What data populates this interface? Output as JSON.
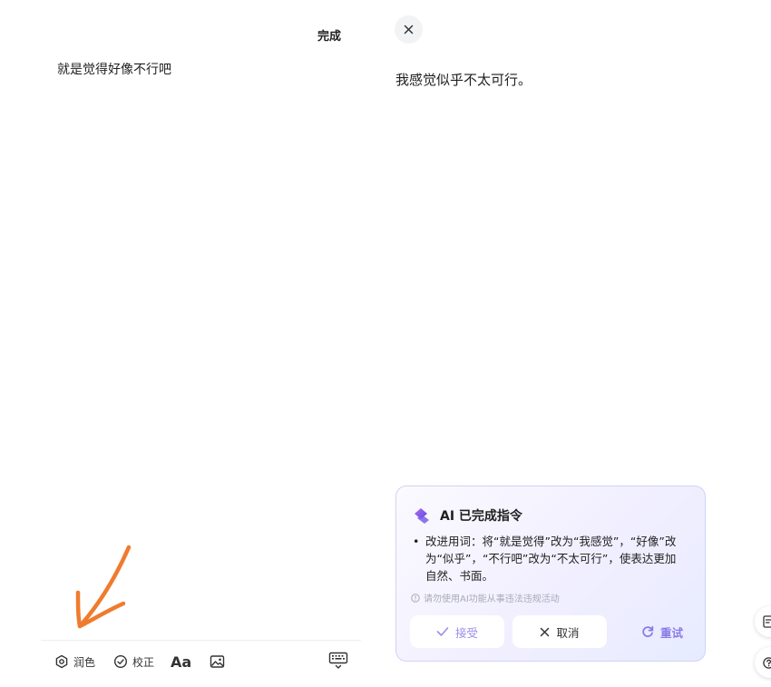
{
  "editor": {
    "done_label": "完成",
    "text": "就是觉得好像不行吧"
  },
  "toolbar": {
    "polish_label": "润色",
    "polish_icon": "polish-icon",
    "check_label": "校正",
    "check_icon": "check-circle-icon",
    "font_label": "Aa",
    "image_icon": "image-icon",
    "keyboard_icon": "keyboard-icon"
  },
  "annotation": {
    "color": "#f07b2e"
  },
  "result": {
    "close_icon": "close-icon",
    "text": "我感觉似乎不太可行。"
  },
  "ai_card": {
    "title": "AI 已完成指令",
    "bullet": "•",
    "body_lines": [
      "改进用词：将“就是觉得”改为“我感觉”，“好像”改",
      "为“似乎”，“不行吧”改为“不太可行”，使表达更加",
      "自然、书面。"
    ],
    "warning": "请勿使用AI功能从事违法违规活动",
    "accept_label": "接受",
    "cancel_label": "取消",
    "retry_label": "重试",
    "accent_color": "#8a7ae6"
  }
}
